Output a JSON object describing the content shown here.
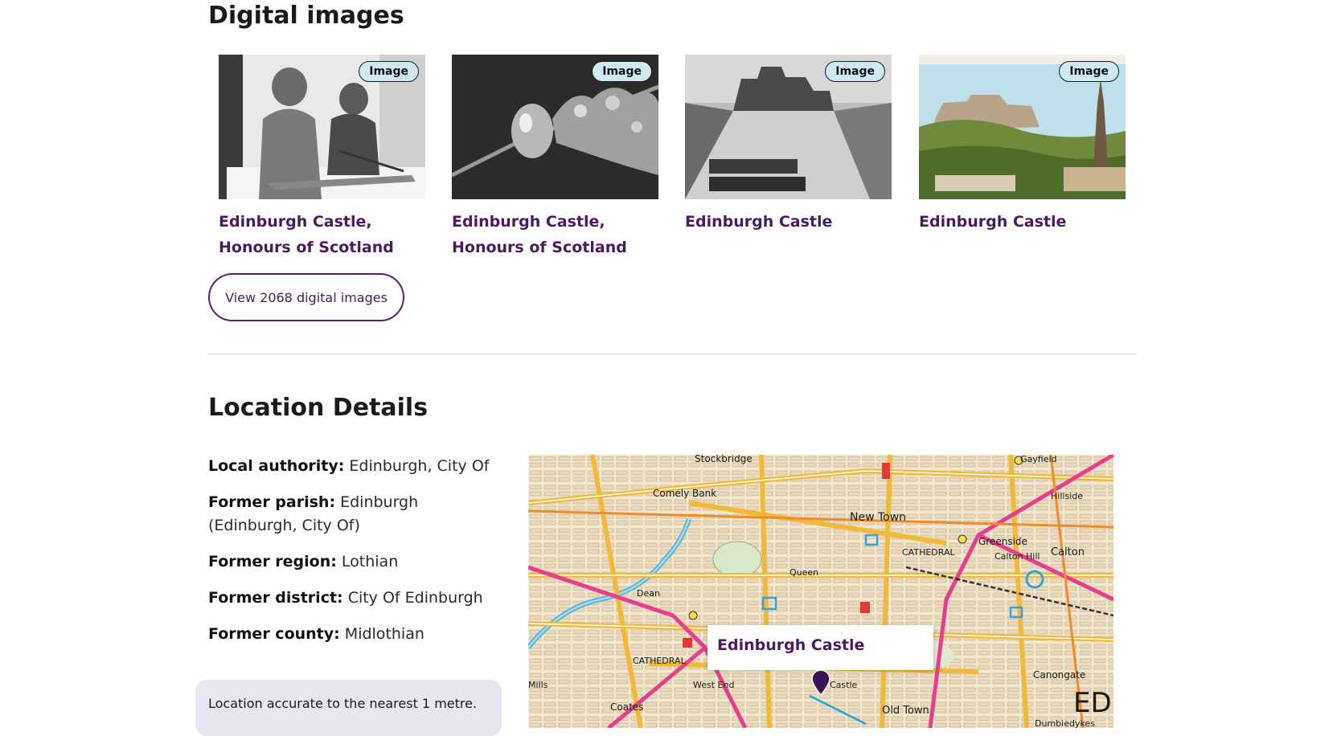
{
  "digital_images": {
    "heading": "Digital images",
    "badge_label": "Image",
    "cards": [
      {
        "title_line1": "Edinburgh Castle,",
        "title_line2": "Honours of Scotland"
      },
      {
        "title_line1": "Edinburgh Castle,",
        "title_line2": "Honours of Scotland"
      },
      {
        "title_line1": "Edinburgh Castle",
        "title_line2": ""
      },
      {
        "title_line1": "Edinburgh Castle",
        "title_line2": ""
      }
    ],
    "view_button": "View 2068 digital images"
  },
  "location": {
    "heading": "Location Details",
    "fields": [
      {
        "label": "Local authority:",
        "value": "Edinburgh, City Of"
      },
      {
        "label": "Former parish:",
        "value": "Edinburgh (Edinburgh, City Of)"
      },
      {
        "label": "Former region:",
        "value": "Lothian"
      },
      {
        "label": "Former district:",
        "value": "City Of Edinburgh"
      },
      {
        "label": "Former county:",
        "value": "Midlothian"
      }
    ],
    "accuracy_note": "Location accurate to the nearest 1 metre."
  },
  "map": {
    "popup_title": "Edinburgh Castle",
    "labels": {
      "stockbridge": "Stockbridge",
      "comely_bank": "Comely Bank",
      "new_town": "New Town",
      "cathedral_ne": "CATHEDRAL",
      "greenside": "Greenside",
      "calton": "Calton",
      "calton_hill": "Calton Hill",
      "hillside": "Hillside",
      "gayfield": "Gayfield",
      "dean": "Dean",
      "cathedral_w": "CATHEDRAL",
      "west_end": "West End",
      "coates": "Coates",
      "canongate": "Canongate",
      "dumbiedykes": "Dumbiedykes",
      "old_town": "Old Town",
      "castle": "Castle",
      "edi": "EDI",
      "mills": "Mills",
      "queen": "Queen"
    }
  },
  "colors": {
    "link_purple": "#4a1b5f",
    "badge_bg": "#cfe9f3",
    "accuracy_bg": "#e8e6f0"
  }
}
